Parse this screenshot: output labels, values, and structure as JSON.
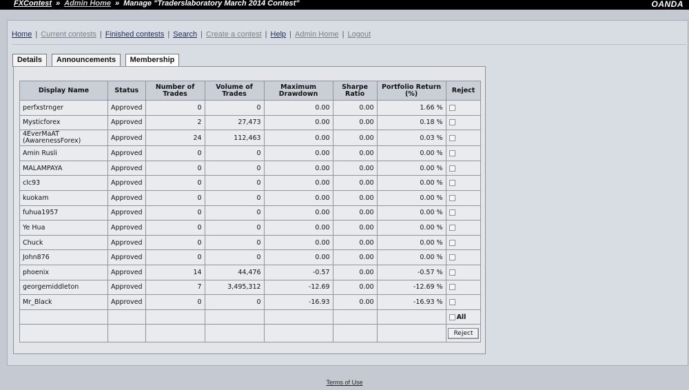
{
  "topbar": {
    "site": "FXContest",
    "admin": "Admin Home",
    "current": "Manage \"Traderslaboratory March 2014 Contest\"",
    "sep": "»",
    "brand": "OANDA"
  },
  "nav": {
    "items": [
      {
        "label": "Home"
      },
      {
        "label": "Current contests"
      },
      {
        "label": "Finished contests"
      },
      {
        "label": "Search"
      },
      {
        "label": "Create a contest"
      },
      {
        "label": "Help"
      },
      {
        "label": "Admin Home"
      },
      {
        "label": "Logout"
      }
    ],
    "separator": "|"
  },
  "tabs": [
    {
      "label": "Details"
    },
    {
      "label": "Announcements"
    },
    {
      "label": "Membership"
    }
  ],
  "table": {
    "headers": {
      "name": "Display Name",
      "status": "Status",
      "trades_1": "Number of",
      "trades_2": "Trades",
      "volume_1": "Volume of",
      "volume_2": "Trades",
      "drawdown_1": "Maximum",
      "drawdown_2": "Drawdown",
      "sharpe_1": "Sharpe",
      "sharpe_2": "Ratio",
      "return_1": "Portfolio Return",
      "return_2": "(%)",
      "reject": "Reject"
    },
    "rows": [
      {
        "name": "perfxstrnger",
        "name2": "",
        "status": "Approved",
        "trades": "0",
        "volume": "0",
        "drawdown": "0.00",
        "sharpe": "0.00",
        "ret": "1.66 %"
      },
      {
        "name": "Mysticforex",
        "name2": "",
        "status": "Approved",
        "trades": "2",
        "volume": "27,473",
        "drawdown": "0.00",
        "sharpe": "0.00",
        "ret": "0.18 %"
      },
      {
        "name": "4EverMaAT",
        "name2": "(AwarenessForex)",
        "status": "Approved",
        "trades": "24",
        "volume": "112,463",
        "drawdown": "0.00",
        "sharpe": "0.00",
        "ret": "0.03 %"
      },
      {
        "name": "Amin Rusli",
        "name2": "",
        "status": "Approved",
        "trades": "0",
        "volume": "0",
        "drawdown": "0.00",
        "sharpe": "0.00",
        "ret": "0.00 %"
      },
      {
        "name": "MALAMPAYA",
        "name2": "",
        "status": "Approved",
        "trades": "0",
        "volume": "0",
        "drawdown": "0.00",
        "sharpe": "0.00",
        "ret": "0.00 %"
      },
      {
        "name": "clc93",
        "name2": "",
        "status": "Approved",
        "trades": "0",
        "volume": "0",
        "drawdown": "0.00",
        "sharpe": "0.00",
        "ret": "0.00 %"
      },
      {
        "name": "kuokam",
        "name2": "",
        "status": "Approved",
        "trades": "0",
        "volume": "0",
        "drawdown": "0.00",
        "sharpe": "0.00",
        "ret": "0.00 %"
      },
      {
        "name": "fuhua1957",
        "name2": "",
        "status": "Approved",
        "trades": "0",
        "volume": "0",
        "drawdown": "0.00",
        "sharpe": "0.00",
        "ret": "0.00 %"
      },
      {
        "name": "Ye Hua",
        "name2": "",
        "status": "Approved",
        "trades": "0",
        "volume": "0",
        "drawdown": "0.00",
        "sharpe": "0.00",
        "ret": "0.00 %"
      },
      {
        "name": "Chuck",
        "name2": "",
        "status": "Approved",
        "trades": "0",
        "volume": "0",
        "drawdown": "0.00",
        "sharpe": "0.00",
        "ret": "0.00 %"
      },
      {
        "name": "John876",
        "name2": "",
        "status": "Approved",
        "trades": "0",
        "volume": "0",
        "drawdown": "0.00",
        "sharpe": "0.00",
        "ret": "0.00 %"
      },
      {
        "name": "phoenix",
        "name2": "",
        "status": "Approved",
        "trades": "14",
        "volume": "44,476",
        "drawdown": "-0.57",
        "sharpe": "0.00",
        "ret": "-0.57 %"
      },
      {
        "name": "georgemiddleton",
        "name2": "",
        "status": "Approved",
        "trades": "7",
        "volume": "3,495,312",
        "drawdown": "-12.69",
        "sharpe": "0.00",
        "ret": "-12.69 %"
      },
      {
        "name": "Mr_Black",
        "name2": "",
        "status": "Approved",
        "trades": "0",
        "volume": "0",
        "drawdown": "-16.93",
        "sharpe": "0.00",
        "ret": "-16.93 %"
      }
    ],
    "all_label": "All",
    "reject_button": "Reject"
  },
  "footer": {
    "terms": "Terms of Use"
  }
}
